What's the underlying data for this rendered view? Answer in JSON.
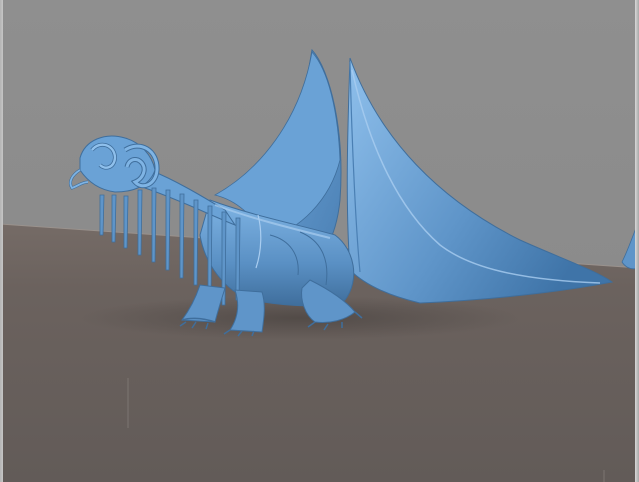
{
  "scene": {
    "subject_icon": "dragon-model-icon",
    "colors": {
      "background": "#8e8e8e",
      "floor": "#6a625e",
      "model": "#5f95c9",
      "model_shadow": "#3f6e9c",
      "model_highlight": "#a9cdf0"
    }
  }
}
